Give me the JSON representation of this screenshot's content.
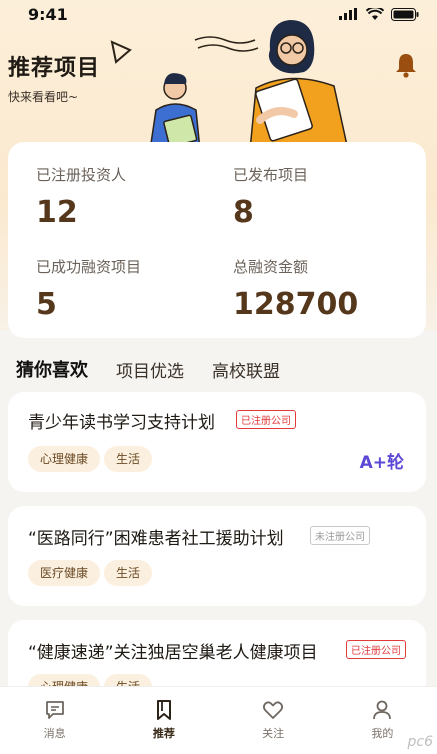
{
  "status_bar": {
    "time": "9:41"
  },
  "header": {
    "title": "推荐项目",
    "subtitle": "快来看看吧~"
  },
  "stats": [
    {
      "label": "已注册投资人",
      "value": "12"
    },
    {
      "label": "已发布项目",
      "value": "8"
    },
    {
      "label": "已成功融资项目",
      "value": "5"
    },
    {
      "label": "总融资金额",
      "value": "128700"
    }
  ],
  "tabs": [
    {
      "label": "猜你喜欢",
      "active": true
    },
    {
      "label": "项目优选",
      "active": false
    },
    {
      "label": "高校联盟",
      "active": false
    }
  ],
  "projects": [
    {
      "title": "青少年读书学习支持计划",
      "badge": "已注册公司",
      "badge_type": "registered",
      "tags": [
        "心理健康",
        "生活"
      ],
      "round": "A+轮"
    },
    {
      "title": "“医路同行”困难患者社工援助计划",
      "badge": "未注册公司",
      "badge_type": "unregistered",
      "tags": [
        "医疗健康",
        "生活"
      ],
      "round": ""
    },
    {
      "title": "“健康速递”关注独居空巢老人健康项目",
      "badge": "已注册公司",
      "badge_type": "registered",
      "tags": [
        "心理健康",
        "生活"
      ],
      "round": ""
    }
  ],
  "tabbar": [
    {
      "label": "消息",
      "icon": "message-icon",
      "active": false
    },
    {
      "label": "推荐",
      "icon": "bookmark-icon",
      "active": true
    },
    {
      "label": "关注",
      "icon": "heart-icon",
      "active": false
    },
    {
      "label": "我的",
      "icon": "user-icon",
      "active": false
    }
  ],
  "watermark": "pc6",
  "colors": {
    "accent_brown": "#55371c",
    "badge_red": "#e03a3a",
    "round_purple": "#5c48d6",
    "tag_bg": "#fbefdf",
    "hero_bg": "#fcefd9"
  }
}
